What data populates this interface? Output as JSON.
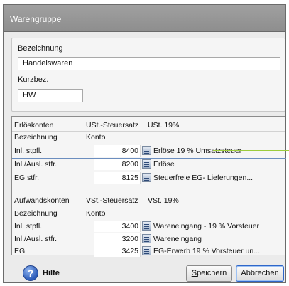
{
  "window": {
    "title": "Warengruppe"
  },
  "form": {
    "bezeichnung_label": "Bezeichnung",
    "bezeichnung_value": "Handelswaren",
    "kurzbez_label_u": "K",
    "kurzbez_label_rest": "urzbez.",
    "kurzbez_value": "HW"
  },
  "revenue": {
    "header": [
      "Erlöskonten",
      "USt.-Steuersatz",
      "USt. 19%"
    ],
    "subheader": [
      "Bezeichnung",
      "Konto"
    ],
    "rows": [
      {
        "label": "Inl. stpfl.",
        "konto": "8400",
        "desc": "Erlöse 19 % Umsatzsteuer"
      },
      {
        "label": "Inl./Ausl. stfr.",
        "konto": "8200",
        "desc": "Erlöse"
      },
      {
        "label": "EG stfr.",
        "konto": "8125",
        "desc": "Steuerfreie EG- Lieferungen..."
      }
    ]
  },
  "expense": {
    "header": [
      "Aufwandskonten",
      "VSt.-Steuersatz",
      "VSt. 19%"
    ],
    "subheader": [
      "Bezeichnung",
      "Konto"
    ],
    "rows": [
      {
        "label": "Inl. stpfl.",
        "konto": "3400",
        "desc": "Wareneingang - 19 % Vorsteuer"
      },
      {
        "label": "Inl./Ausl. stfr.",
        "konto": "3200",
        "desc": "Wareneingang"
      },
      {
        "label": "EG",
        "konto": "3425",
        "desc": "EG-Erwerb 19 % Vorsteuer un..."
      }
    ]
  },
  "footer": {
    "help_label": "Hilfe",
    "save_u": "S",
    "save_rest": "peichern",
    "cancel_label": "Abbrechen"
  },
  "colors": {
    "titlebar": "#969696",
    "accent": "#2f66c8",
    "guide_line": "#9ccc3c"
  }
}
